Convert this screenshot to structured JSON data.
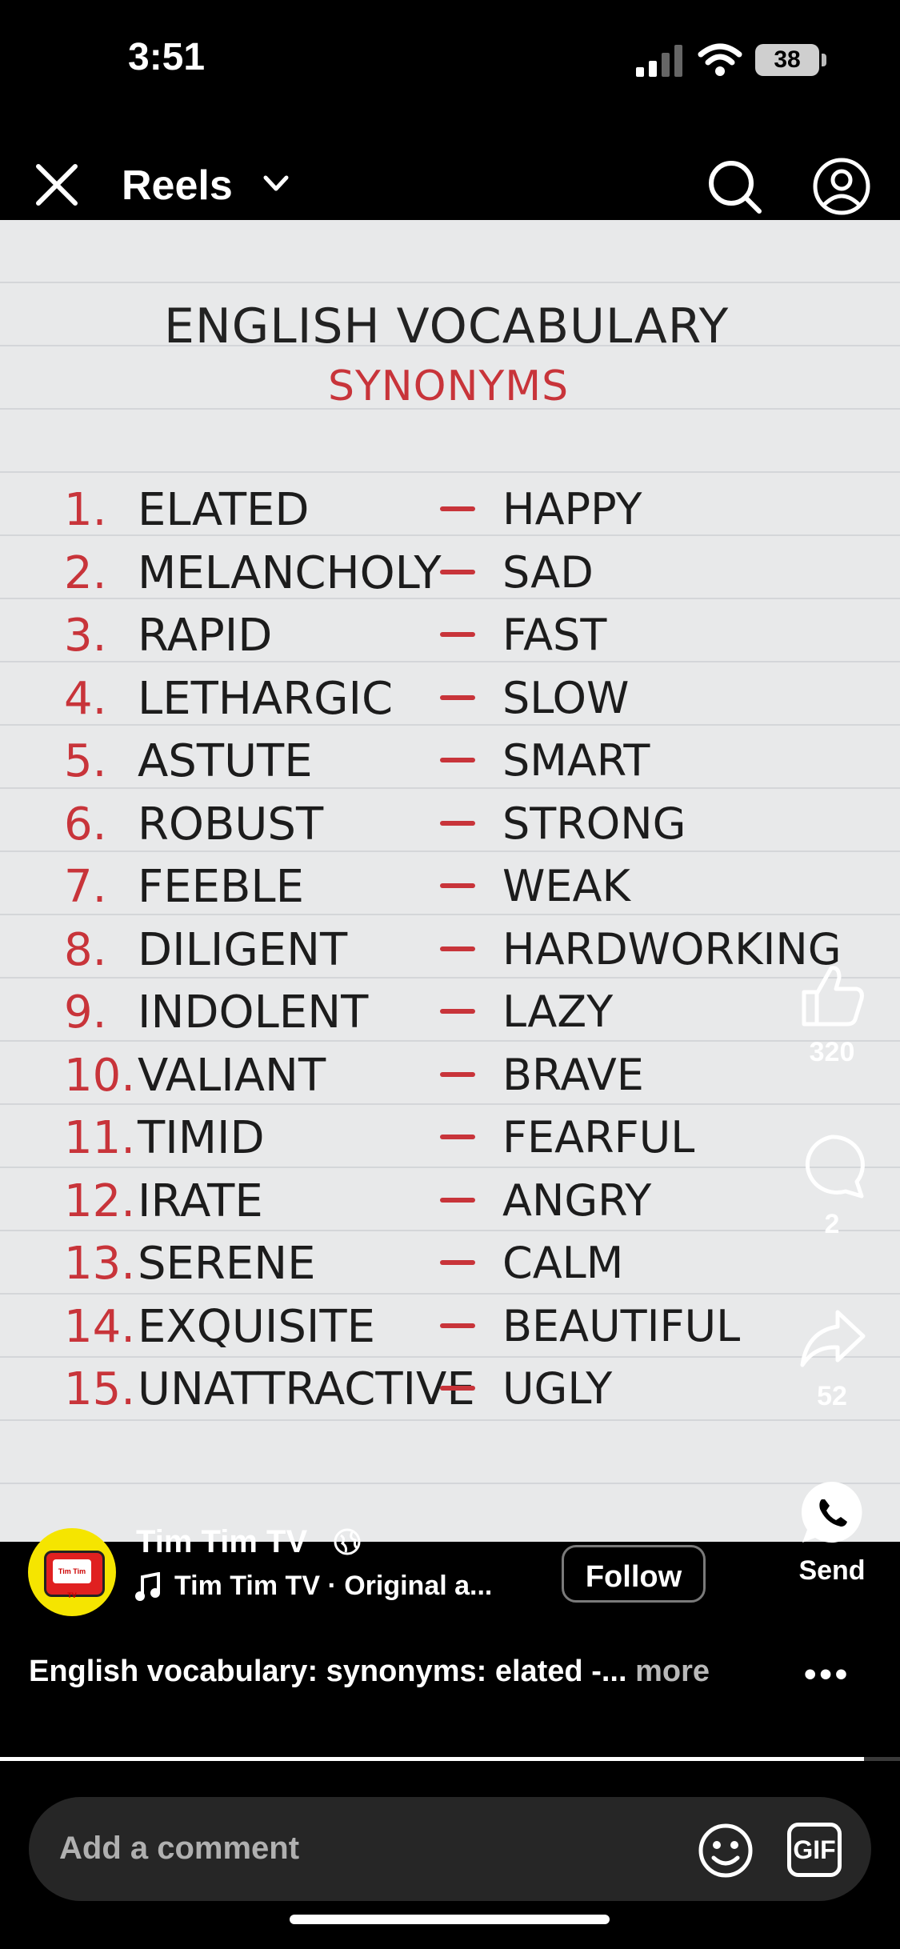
{
  "status_bar": {
    "time": "3:51",
    "battery": "38"
  },
  "nav": {
    "title": "Reels"
  },
  "video": {
    "title": "ENGLISH VOCABULARY",
    "subtitle": "SYNONYMS",
    "pairs": [
      {
        "num": "1.",
        "word": "ELATED",
        "synonym": "HAPPY"
      },
      {
        "num": "2.",
        "word": "MELANCHOLY",
        "synonym": "SAD"
      },
      {
        "num": "3.",
        "word": "RAPID",
        "synonym": "FAST"
      },
      {
        "num": "4.",
        "word": "LETHARGIC",
        "synonym": "SLOW"
      },
      {
        "num": "5.",
        "word": "ASTUTE",
        "synonym": "SMART"
      },
      {
        "num": "6.",
        "word": "ROBUST",
        "synonym": "STRONG"
      },
      {
        "num": "7.",
        "word": "FEEBLE",
        "synonym": "WEAK"
      },
      {
        "num": "8.",
        "word": "DILIGENT",
        "synonym": "HARDWORKING"
      },
      {
        "num": "9.",
        "word": "INDOLENT",
        "synonym": "LAZY"
      },
      {
        "num": "10.",
        "word": "VALIANT",
        "synonym": "BRAVE"
      },
      {
        "num": "11.",
        "word": "TIMID",
        "synonym": "FEARFUL"
      },
      {
        "num": "12.",
        "word": "IRATE",
        "synonym": "ANGRY"
      },
      {
        "num": "13.",
        "word": "SERENE",
        "synonym": "CALM"
      },
      {
        "num": "14.",
        "word": "EXQUISITE",
        "synonym": "BEAUTIFUL"
      },
      {
        "num": "15.",
        "word": "UNATTRACTIVE",
        "synonym": "UGLY"
      }
    ]
  },
  "rail": {
    "likes": "320",
    "comments": "2",
    "shares": "52",
    "send_label": "Send"
  },
  "creator": {
    "name": "Tim Tim TV",
    "audio": "Tim Tim TV · Original a...",
    "follow_label": "Follow",
    "avatar_text": "Tim Tim TV"
  },
  "caption": {
    "text": "English vocabulary: synonyms: elated -... ",
    "more": "more"
  },
  "playback": {
    "progress_fraction": 0.96
  },
  "comment": {
    "placeholder": "Add a comment",
    "gif_label": "GIF"
  },
  "icons": [
    "close-icon",
    "chevron-down-icon",
    "search-icon",
    "profile-icon",
    "like-icon",
    "comment-icon",
    "share-icon",
    "whatsapp-icon",
    "globe-icon",
    "music-note-icon",
    "emoji-icon",
    "gif-icon"
  ],
  "colors": {
    "accent_red": "#c8343a",
    "avatar_yellow": "#f5e500"
  }
}
